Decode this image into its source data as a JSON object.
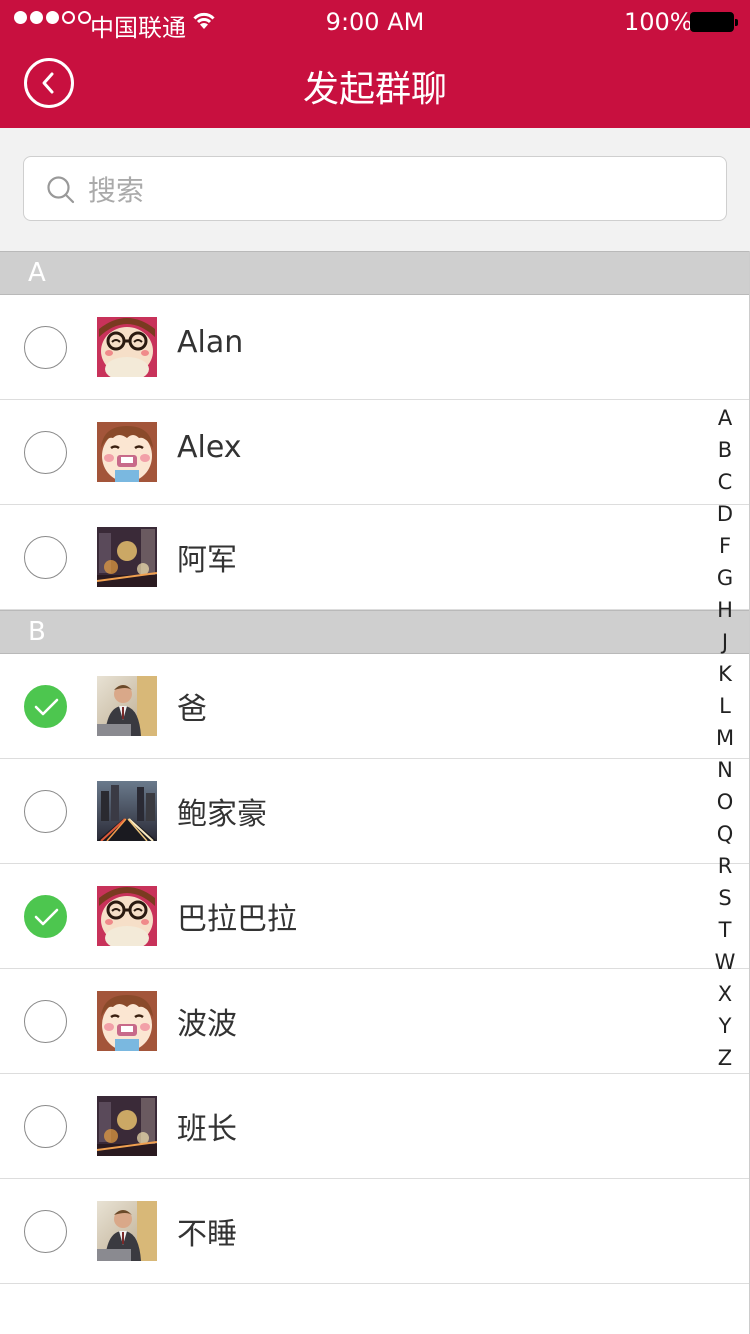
{
  "status_bar": {
    "carrier": "中国联通",
    "time": "9:00 AM",
    "battery": "100%"
  },
  "header": {
    "title": "发起群聊"
  },
  "search": {
    "placeholder": "搜索",
    "value": ""
  },
  "sections": [
    {
      "letter": "A",
      "contacts": [
        {
          "name": "Alan",
          "selected": false,
          "avatar": "cartoon-glasses-avatar"
        },
        {
          "name": "Alex",
          "selected": false,
          "avatar": "cartoon-girl-avatar"
        },
        {
          "name": "阿军",
          "selected": false,
          "avatar": "city-lights-avatar"
        }
      ]
    },
    {
      "letter": "B",
      "contacts": [
        {
          "name": "爸",
          "selected": true,
          "avatar": "businessman-avatar"
        },
        {
          "name": "鲍家豪",
          "selected": false,
          "avatar": "city-road-avatar"
        },
        {
          "name": "巴拉巴拉",
          "selected": true,
          "avatar": "cartoon-glasses-avatar"
        },
        {
          "name": "波波",
          "selected": false,
          "avatar": "cartoon-girl-avatar"
        },
        {
          "name": "班长",
          "selected": false,
          "avatar": "city-lights-avatar"
        },
        {
          "name": "不睡",
          "selected": false,
          "avatar": "businessman-avatar"
        }
      ]
    }
  ],
  "index_letters": [
    "A",
    "B",
    "C",
    "D",
    "F",
    "G",
    "H",
    "J",
    "K",
    "L",
    "M",
    "N",
    "O",
    "Q",
    "R",
    "S",
    "T",
    "W",
    "X",
    "Y",
    "Z"
  ],
  "colors": {
    "brand": "#c8103f",
    "checked": "#4dc64f",
    "section_bg": "#cfcfcf"
  }
}
